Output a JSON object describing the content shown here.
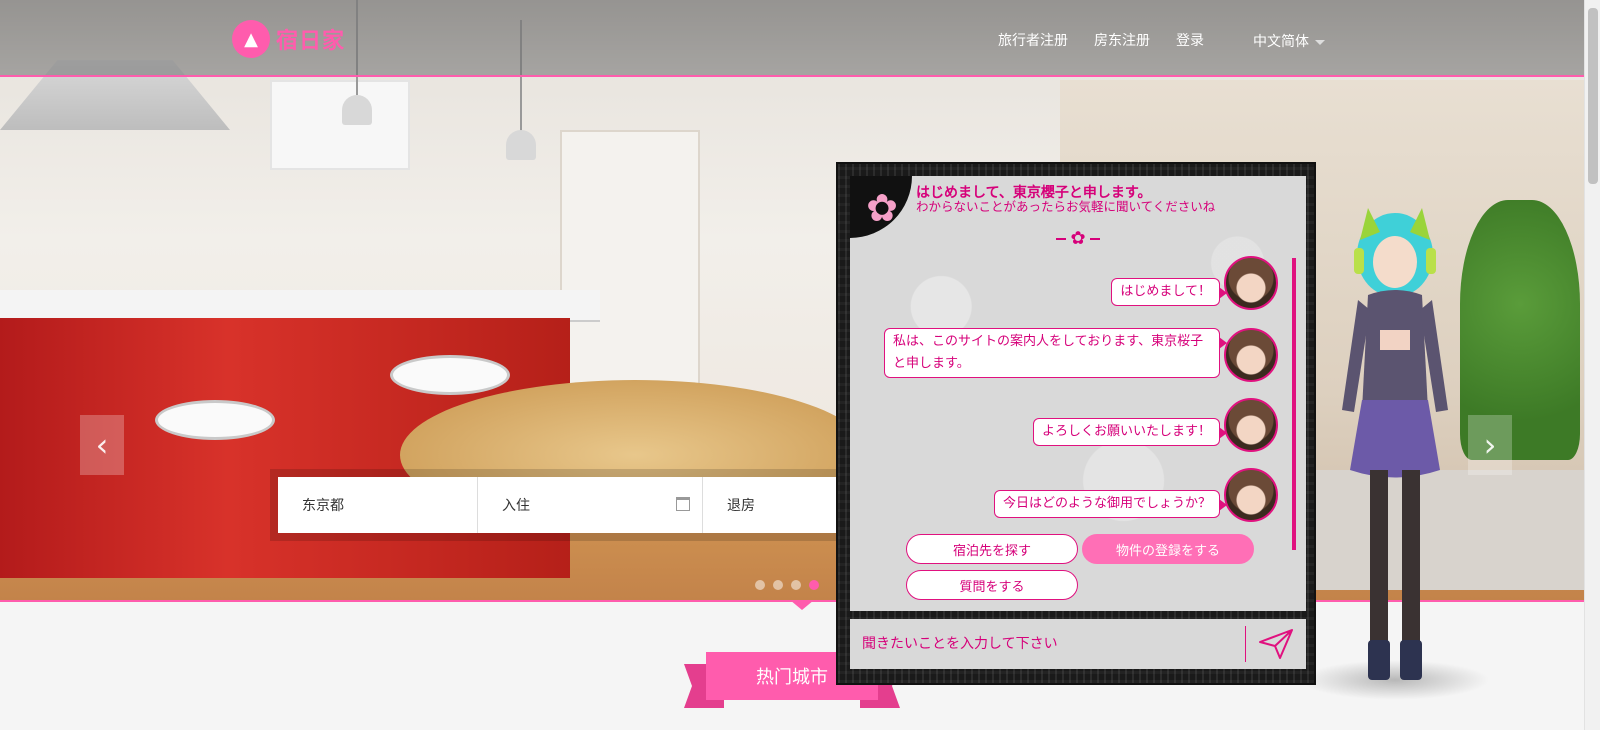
{
  "header": {
    "logo_text": "宿日家",
    "nav": [
      "旅行者注册",
      "房东注册",
      "登录"
    ],
    "language": "中文简体"
  },
  "search": {
    "location": "东京都",
    "checkin": "入住",
    "checkout": "退房"
  },
  "chat": {
    "title": "はじめまして、東京櫻子と申します。",
    "subtitle": "わからないことがあったらお気軽に聞いてくださいね",
    "messages": [
      "はじめまして！",
      "私は、このサイトの案内人をしております、東京桜子と申します。",
      "よろしくお願いいたします！",
      "今日はどのような御用でしょうか？"
    ],
    "options": [
      "宿泊先を探す",
      "物件の登録をする",
      "質問をする"
    ],
    "input_placeholder": "聞きたいことを入力して下さい"
  },
  "section": {
    "hot_cities": "热门城市"
  },
  "colors": {
    "accent": "#ff5cad",
    "chat_text": "#d6007a"
  }
}
